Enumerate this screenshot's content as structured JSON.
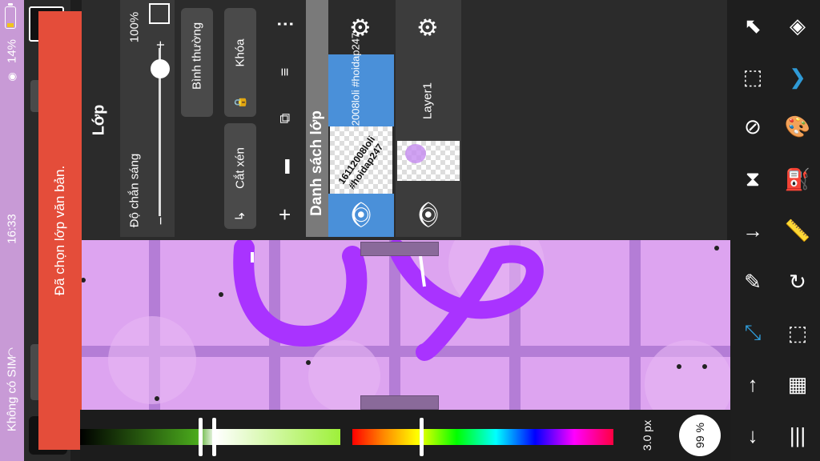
{
  "status": {
    "battery": "14%",
    "time": "16:33",
    "carrier": "Không có SIM"
  },
  "toast": {
    "message": "Đã chọn lớp văn bản."
  },
  "panel": {
    "title": "Lớp",
    "opacity_label": "Độ chắn sáng",
    "opacity_value": "100%",
    "blend_mode": "Bình thường",
    "lock_label": "Khóa",
    "clip_label": "Cắt xén",
    "layer_list_title": "Danh sách lớp",
    "layers": [
      {
        "name": "16112008loli\n#hoidap247",
        "thumb_text": "16112008loli #hoidap247",
        "selected": true
      },
      {
        "name": "Layer1",
        "thumb_text": "",
        "selected": false
      }
    ]
  },
  "brush": {
    "size": "3.0",
    "unit": "px",
    "zoom": "99 %"
  },
  "colors": {
    "canvas_bg": "#dda4f0",
    "stroke": "#a933ff",
    "selected_layer": "#4a90d9",
    "toast_bg": "#e44d3a",
    "accent_blue": "#2f9ad6"
  },
  "toolbar": {
    "icons": [
      "move-icon",
      "layers-icon",
      "transform-icon",
      "brush-stack-icon",
      "lasso-icon",
      "palette-icon",
      "flip-icon",
      "fill-icon",
      "import-icon",
      "ruler-icon",
      "eyedropper-icon",
      "rotate-icon",
      "select-brush-icon",
      "selection-icon",
      "undo-icon",
      "grid-icon",
      "redo-icon",
      "menu-icon"
    ]
  }
}
